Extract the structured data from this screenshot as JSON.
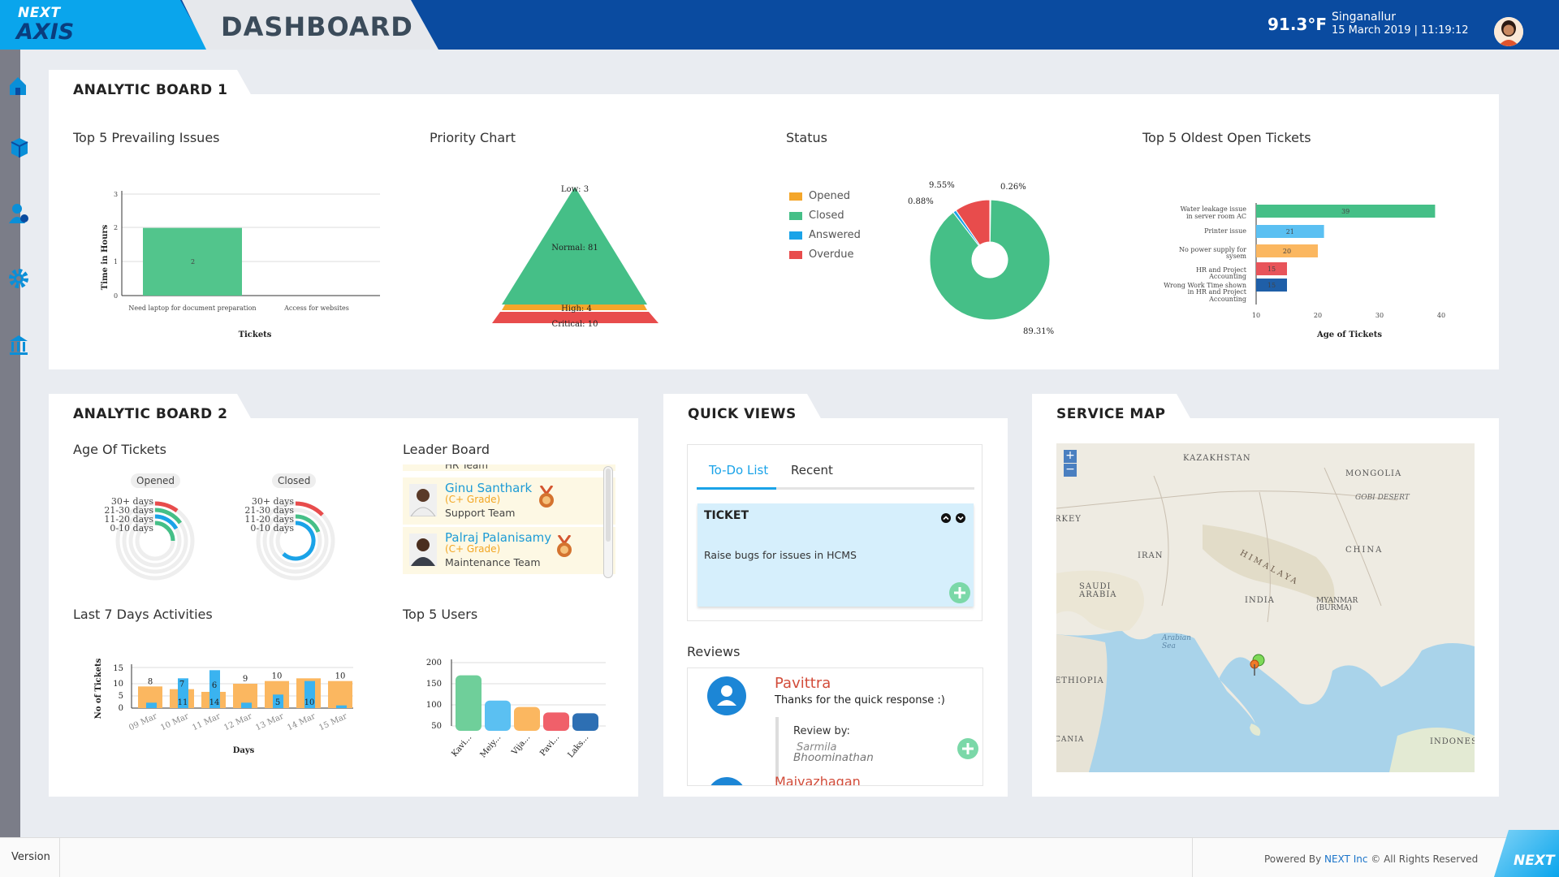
{
  "header": {
    "logo_top": "NEXT",
    "logo_bottom": "AXIS",
    "title": "DASHBOARD",
    "temperature": "91.3°F",
    "location": "Singanallur",
    "datetime": "15 March 2019 | 11:19:12",
    "brand_color": "#0a4ba0",
    "accent_color": "#0aa5ec"
  },
  "sidebar": {
    "icons": [
      "home-icon",
      "cube-icon",
      "user-settings-icon",
      "gear-icon",
      "bank-icon"
    ]
  },
  "board1": {
    "title": "ANALYTIC BOARD 1",
    "issues": {
      "title": "Top 5 Prevailing Issues",
      "ylabel": "Time in Hours",
      "xlabel": "Tickets",
      "yticks": [
        "0",
        "1",
        "2",
        "3"
      ],
      "bar_label": "2"
    },
    "priority": {
      "title": "Priority Chart",
      "labels": [
        "Low: 3",
        "Normal: 81",
        "High: 4",
        "Critical: 10"
      ]
    },
    "status": {
      "title": "Status",
      "legend": [
        {
          "label": "Opened",
          "color": "#f4a62a"
        },
        {
          "label": "Closed",
          "color": "#45bf87"
        },
        {
          "label": "Answered",
          "color": "#1aa3e8"
        },
        {
          "label": "Overdue",
          "color": "#e84c4c"
        }
      ],
      "pct_labels": [
        "9.55%",
        "0.26%",
        "0.88%",
        "89.31%"
      ]
    },
    "oldest": {
      "title": "Top 5 Oldest Open Tickets",
      "xlabel": "Age of Tickets",
      "xticks": [
        "10",
        "20",
        "30",
        "40"
      ],
      "value_labels": [
        "39",
        "21",
        "20",
        "15",
        "15"
      ]
    }
  },
  "board2": {
    "title": "ANALYTIC BOARD 2",
    "age": {
      "title": "Age Of Tickets",
      "opened": "Opened",
      "closed": "Closed",
      "ranges": [
        "30+ days",
        "21-30 days",
        "11-20 days",
        "0-10 days"
      ]
    },
    "leader": {
      "title": "Leader Board",
      "partial_team": "HR Team",
      "rows": [
        {
          "name": "Ginu Santhark",
          "grade": "(C+ Grade)",
          "team": "Support Team"
        },
        {
          "name": "Palraj Palanisamy",
          "grade": "(C+ Grade)",
          "team": "Maintenance Team"
        }
      ]
    },
    "last7": {
      "title": "Last 7 Days Activities",
      "ylabel": "No of Tickets",
      "xlabel": "Days",
      "yticks": [
        "0",
        "5",
        "10",
        "15"
      ],
      "bar_labels_orange": [
        "8",
        "7",
        "",
        "9",
        "10",
        "",
        "10"
      ],
      "bar_labels_blue": [
        "",
        "11",
        "14",
        "",
        "5",
        "10",
        ""
      ],
      "top_blue": "6"
    },
    "top5": {
      "title": "Top 5 Users",
      "yticks": [
        "50",
        "100",
        "150",
        "200"
      ]
    }
  },
  "quick": {
    "title": "QUICK VIEWS",
    "tabs": [
      "To-Do List",
      "Recent"
    ],
    "card_title": "TICKET",
    "card_text": "Raise bugs for issues in HCMS",
    "reviews_title": "Reviews",
    "review_name": "Pavittra",
    "review_text": "Thanks for the quick response :)",
    "review_by": "Review by:",
    "review_by_names": [
      "Sarmila",
      "Bhoominathan"
    ],
    "review_next": "Maivazhagan"
  },
  "map": {
    "title": "SERVICE MAP",
    "labels": [
      "KAZAKHSTAN",
      "MONGOLIA",
      "GOBI DESERT",
      "RKEY",
      "IRAN",
      "CHINA",
      "HIMALAYA",
      "SAUDI ARABIA",
      "INDIA",
      "MYANMAR (BURMA)",
      "Arabian Sea",
      "ETHIOPIA",
      "CANIA",
      "INDONESI"
    ],
    "zoom_in": "+",
    "zoom_out": "−"
  },
  "footer": {
    "version": "Version",
    "powered_prefix": "Powered By ",
    "company": "NEXT Inc",
    "suffix": " © All Rights Reserved",
    "corner": "NEXT"
  },
  "chart_data": [
    {
      "type": "bar",
      "title": "Top 5 Prevailing Issues",
      "xlabel": "Tickets",
      "ylabel": "Time in Hours",
      "categories": [
        "Need laptop for document preparation",
        "Access for websites"
      ],
      "values": [
        2,
        0
      ],
      "ylim": [
        0,
        3
      ]
    },
    {
      "type": "pie",
      "title": "Priority Chart",
      "categories": [
        "Low",
        "Normal",
        "High",
        "Critical"
      ],
      "values": [
        3,
        81,
        4,
        10
      ]
    },
    {
      "type": "pie",
      "title": "Status",
      "categories": [
        "Opened",
        "Closed",
        "Answered",
        "Overdue"
      ],
      "values": [
        0.26,
        89.31,
        0.88,
        9.55
      ]
    },
    {
      "type": "bar",
      "title": "Top 5 Oldest Open Tickets",
      "xlabel": "Age of Tickets",
      "categories": [
        "Water leakage issue in server room AC",
        "Printer issue",
        "No power supply for sysem",
        "HR and Project Accounting",
        "Wrong Work Time shown in HR and Project Accounting"
      ],
      "values": [
        39,
        21,
        20,
        15,
        15
      ],
      "xlim": [
        10,
        40
      ]
    },
    {
      "type": "bar",
      "title": "Last 7 Days Activities",
      "xlabel": "Days",
      "ylabel": "No of Tickets",
      "categories": [
        "09 Mar",
        "10 Mar",
        "11 Mar",
        "12 Mar",
        "13 Mar",
        "14 Mar",
        "15 Mar"
      ],
      "series": [
        {
          "values": [
            8,
            7,
            6,
            9,
            10,
            11,
            10
          ]
        },
        {
          "values": [
            2,
            11,
            14,
            2,
            5,
            10,
            1
          ]
        }
      ],
      "ylim": [
        0,
        15
      ]
    },
    {
      "type": "bar",
      "title": "Top 5 Users",
      "categories": [
        "Kavi...",
        "Meiy...",
        "Vija...",
        "Pavi...",
        "Laks..."
      ],
      "values": [
        170,
        110,
        95,
        82,
        80
      ],
      "ylim": [
        50,
        200
      ]
    }
  ]
}
